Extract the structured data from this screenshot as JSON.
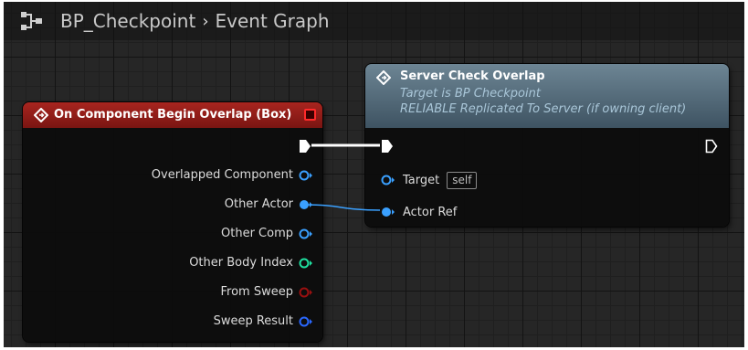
{
  "breadcrumb": {
    "blueprint": "BP_Checkpoint",
    "separator": "›",
    "graph": "Event Graph"
  },
  "event_node": {
    "title": "On Component Begin Overlap (Box)",
    "header_color": "#9b1f1a",
    "pins": [
      {
        "label": "Overlapped Component",
        "color": "#3aa0ff",
        "connected": false
      },
      {
        "label": "Other Actor",
        "color": "#3aa0ff",
        "connected": true
      },
      {
        "label": "Other Comp",
        "color": "#3aa0ff",
        "connected": false
      },
      {
        "label": "Other Body Index",
        "color": "#1fe0a0",
        "connected": false
      },
      {
        "label": "From Sweep",
        "color": "#9a1010",
        "connected": false
      },
      {
        "label": "Sweep Result",
        "color": "#2a68ff",
        "connected": false
      }
    ]
  },
  "server_node": {
    "title": "Server Check Overlap",
    "subtitle_target": "Target is BP Checkpoint",
    "subtitle_replication": "RELIABLE Replicated To Server (if owning client)",
    "header_color": "#5a7282",
    "pins": {
      "target_label": "Target",
      "target_default": "self",
      "actor_ref_label": "Actor Ref"
    }
  },
  "colors": {
    "exec": "#ffffff",
    "object_pin": "#3aa0ff",
    "integer_pin": "#1fe0a0",
    "bool_pin": "#9a1010",
    "struct_pin": "#2a68ff"
  }
}
